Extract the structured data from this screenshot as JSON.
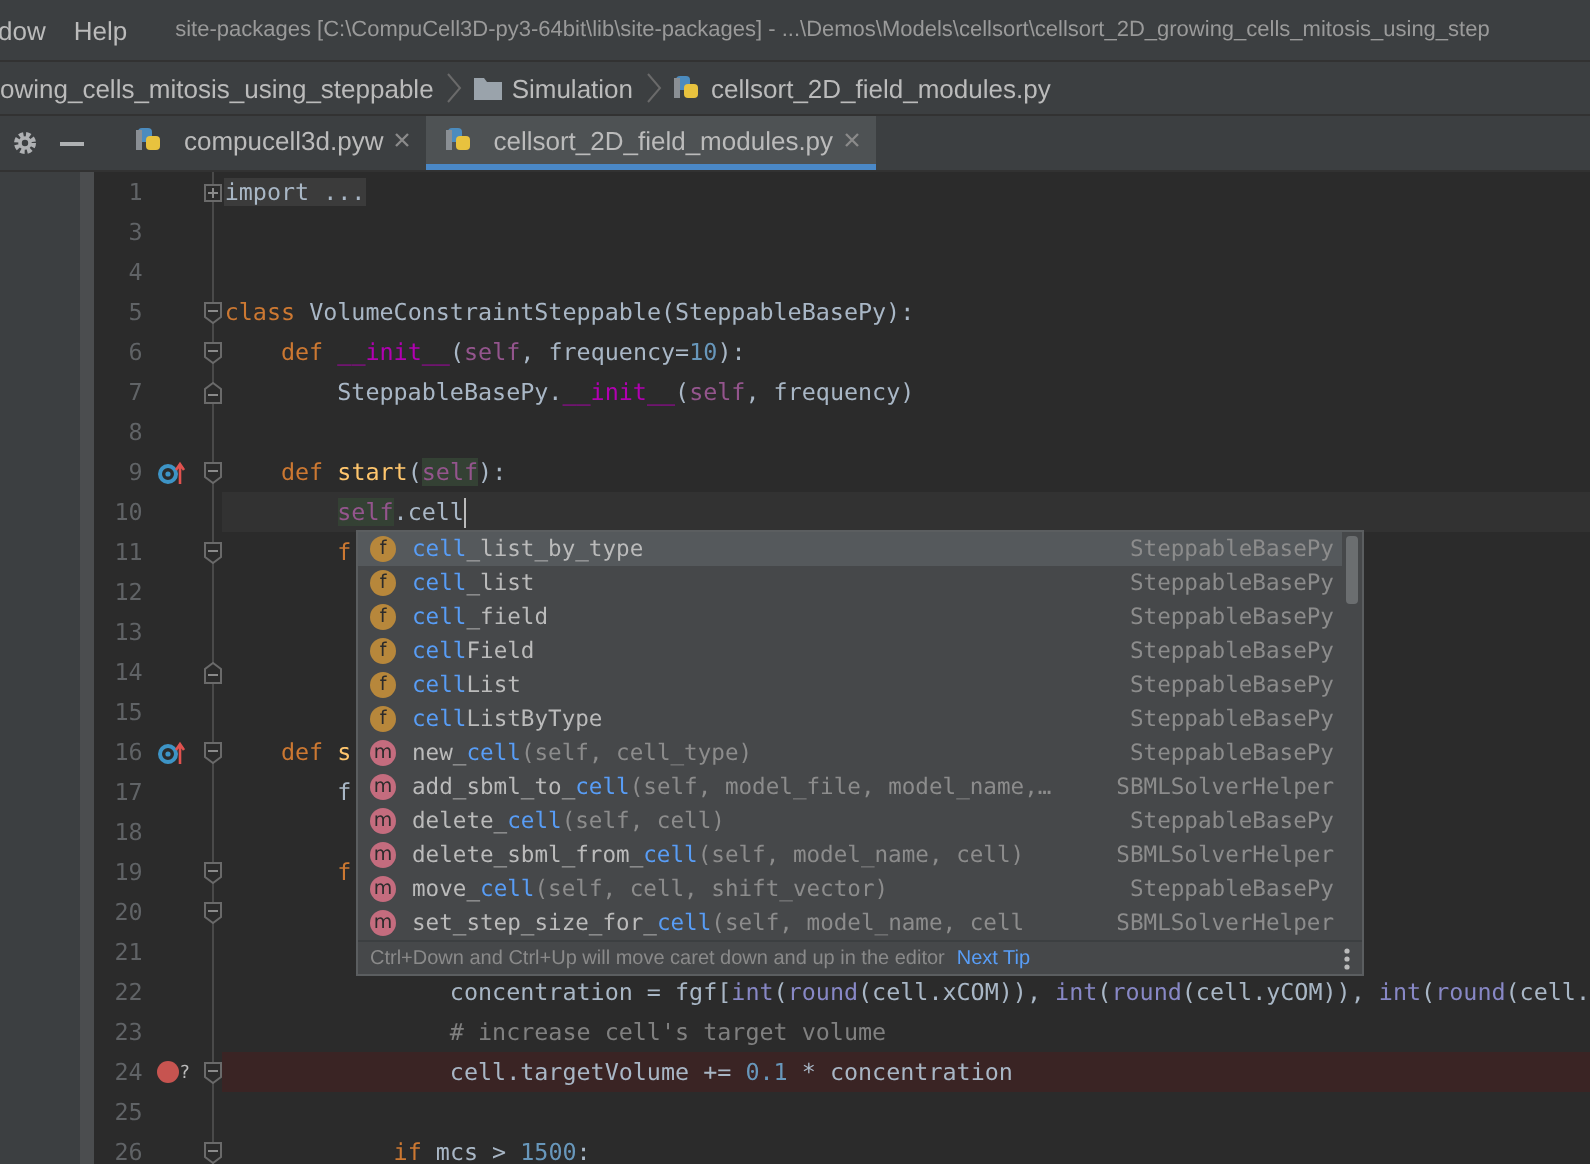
{
  "menu_bar": {
    "items": [
      {
        "label": "dow"
      },
      {
        "label": "Help"
      }
    ],
    "title": "site-packages [C:\\CompuCell3D-py3-64bit\\lib\\site-packages] - ...\\Demos\\Models\\cellsort\\cellsort_2D_growing_cells_mitosis_using_step"
  },
  "breadcrumbs": [
    {
      "label": "owing_cells_mitosis_using_steppable",
      "kind": "text"
    },
    {
      "label": "Simulation",
      "kind": "folder"
    },
    {
      "label": "cellsort_2D_field_modules.py",
      "kind": "python"
    }
  ],
  "tabs": [
    {
      "label": "compucell3d.pyw",
      "selected": false
    },
    {
      "label": "cellsort_2D_field_modules.py",
      "selected": true
    }
  ],
  "editor": {
    "lines": [
      {
        "number": "1",
        "fold": {
          "kind": "expand"
        },
        "current": false,
        "tokens": [
          {
            "text": "import ...",
            "kind": "folded"
          }
        ]
      },
      {
        "number": "3",
        "current": false
      },
      {
        "number": "4",
        "current": false
      },
      {
        "number": "5",
        "fold": {
          "kind": "collapse"
        },
        "current": false,
        "tokens": [
          {
            "text": "class",
            "kind": "keyword"
          },
          {
            "text": " VolumeConstraintSteppable(SteppableBasePy):",
            "kind": "plain"
          }
        ]
      },
      {
        "number": "6",
        "fold": {
          "kind": "collapse"
        },
        "current": false,
        "tokens": [
          {
            "text": "    def",
            "kind": "keyword"
          },
          {
            "text": " __init__",
            "kind": "magic"
          },
          {
            "text": "(",
            "kind": "plain"
          },
          {
            "text": "self",
            "kind": "self"
          },
          {
            "text": ", frequency=",
            "kind": "plain"
          },
          {
            "text": "10",
            "kind": "number"
          },
          {
            "text": "):",
            "kind": "plain"
          }
        ]
      },
      {
        "number": "7",
        "fold": {
          "kind": "end"
        },
        "current": false,
        "tokens": [
          {
            "text": "        SteppableBasePy.",
            "kind": "plain"
          },
          {
            "text": "__init__",
            "kind": "magic"
          },
          {
            "text": "(",
            "kind": "plain"
          },
          {
            "text": "self",
            "kind": "self"
          },
          {
            "text": ", frequency)",
            "kind": "plain"
          }
        ]
      },
      {
        "number": "8",
        "current": false
      },
      {
        "number": "9",
        "fold": {
          "kind": "collapse"
        },
        "marker": {
          "kind": "override"
        },
        "current": false,
        "tokens": [
          {
            "text": "    def",
            "kind": "keyword"
          },
          {
            "text": " start",
            "kind": "function"
          },
          {
            "text": "(",
            "kind": "plain"
          },
          {
            "text": "self",
            "kind": "self-usage"
          },
          {
            "text": "):",
            "kind": "plain"
          }
        ]
      },
      {
        "number": "10",
        "current": true,
        "tokens": [
          {
            "text": "        self",
            "kind": "self-usage"
          },
          {
            "text": ".cell",
            "kind": "plain"
          }
        ]
      },
      {
        "number": "11",
        "fold": {
          "kind": "collapse"
        },
        "current": false,
        "tokens": [
          {
            "text": "        f",
            "kind": "keyword"
          }
        ]
      },
      {
        "number": "12",
        "current": false
      },
      {
        "number": "13",
        "current": false
      },
      {
        "number": "14",
        "fold": {
          "kind": "end"
        },
        "current": false
      },
      {
        "number": "15",
        "current": false
      },
      {
        "number": "16",
        "fold": {
          "kind": "collapse"
        },
        "marker": {
          "kind": "override"
        },
        "current": false,
        "tokens": [
          {
            "text": "    def",
            "kind": "keyword"
          },
          {
            "text": " s",
            "kind": "function"
          }
        ]
      },
      {
        "number": "17",
        "current": false,
        "tokens": [
          {
            "text": "        f",
            "kind": "plain"
          }
        ]
      },
      {
        "number": "18",
        "current": false
      },
      {
        "number": "19",
        "fold": {
          "kind": "collapse"
        },
        "current": false,
        "tokens": [
          {
            "text": "        f",
            "kind": "keyword"
          }
        ]
      },
      {
        "number": "20",
        "fold": {
          "kind": "collapse"
        },
        "current": false
      },
      {
        "number": "21",
        "current": false
      },
      {
        "number": "22",
        "current": false,
        "tokens": [
          {
            "text": "                concentration = fgf[",
            "kind": "plain"
          },
          {
            "text": "int",
            "kind": "builtin"
          },
          {
            "text": "(",
            "kind": "plain"
          },
          {
            "text": "round",
            "kind": "builtin"
          },
          {
            "text": "(cell.xCOM)), ",
            "kind": "plain"
          },
          {
            "text": "int",
            "kind": "builtin"
          },
          {
            "text": "(",
            "kind": "plain"
          },
          {
            "text": "round",
            "kind": "builtin"
          },
          {
            "text": "(cell.yCOM)), ",
            "kind": "plain"
          },
          {
            "text": "int",
            "kind": "builtin"
          },
          {
            "text": "(",
            "kind": "plain"
          },
          {
            "text": "round",
            "kind": "builtin"
          },
          {
            "text": "(cell.",
            "kind": "plain"
          }
        ]
      },
      {
        "number": "23",
        "current": false,
        "tokens": [
          {
            "text": "                # increase cell's target volume",
            "kind": "comment"
          }
        ]
      },
      {
        "number": "24",
        "fold": {
          "kind": "collapse"
        },
        "marker": {
          "kind": "breakpoint",
          "label": "?"
        },
        "current": false,
        "tokens": [
          {
            "text": "                cell.targetVolume += ",
            "kind": "plain"
          },
          {
            "text": "0.1",
            "kind": "number"
          },
          {
            "text": " * concentration",
            "kind": "plain"
          }
        ]
      },
      {
        "number": "25",
        "current": false
      },
      {
        "number": "26",
        "fold": {
          "kind": "collapse"
        },
        "current": false,
        "tokens": [
          {
            "text": "            if",
            "kind": "keyword"
          },
          {
            "text": " mcs > ",
            "kind": "plain"
          },
          {
            "text": "1500",
            "kind": "number"
          },
          {
            "text": ":",
            "kind": "plain"
          }
        ]
      }
    ]
  },
  "completion": {
    "items": [
      {
        "kind": "field",
        "icon_letter": "f",
        "selected": true,
        "name_parts": [
          {
            "text": "cell",
            "matched": true
          },
          {
            "text": "_list_by_type",
            "matched": false
          }
        ],
        "source": "SteppableBasePy"
      },
      {
        "kind": "field",
        "icon_letter": "f",
        "selected": false,
        "name_parts": [
          {
            "text": "cell",
            "matched": true
          },
          {
            "text": "_list",
            "matched": false
          }
        ],
        "source": "SteppableBasePy"
      },
      {
        "kind": "field",
        "icon_letter": "f",
        "selected": false,
        "name_parts": [
          {
            "text": "cell",
            "matched": true
          },
          {
            "text": "_field",
            "matched": false
          }
        ],
        "source": "SteppableBasePy"
      },
      {
        "kind": "field",
        "icon_letter": "f",
        "selected": false,
        "name_parts": [
          {
            "text": "cell",
            "matched": true
          },
          {
            "text": "Field",
            "matched": false
          }
        ],
        "source": "SteppableBasePy"
      },
      {
        "kind": "field",
        "icon_letter": "f",
        "selected": false,
        "name_parts": [
          {
            "text": "cell",
            "matched": true
          },
          {
            "text": "List",
            "matched": false
          }
        ],
        "source": "SteppableBasePy"
      },
      {
        "kind": "field",
        "icon_letter": "f",
        "selected": false,
        "name_parts": [
          {
            "text": "cell",
            "matched": true
          },
          {
            "text": "ListByType",
            "matched": false
          }
        ],
        "source": "SteppableBasePy"
      },
      {
        "kind": "method",
        "icon_letter": "m",
        "selected": false,
        "name_parts": [
          {
            "text": "new_",
            "matched": false
          },
          {
            "text": "cell",
            "matched": true
          }
        ],
        "params": "(self, cell_type)",
        "source": "SteppableBasePy"
      },
      {
        "kind": "method",
        "icon_letter": "m",
        "selected": false,
        "name_parts": [
          {
            "text": "add_sbml_to_",
            "matched": false
          },
          {
            "text": "cell",
            "matched": true
          }
        ],
        "params": "(self, model_file, model_name,…",
        "source": "SBMLSolverHelper"
      },
      {
        "kind": "method",
        "icon_letter": "m",
        "selected": false,
        "name_parts": [
          {
            "text": "delete_",
            "matched": false
          },
          {
            "text": "cell",
            "matched": true
          }
        ],
        "params": "(self, cell)",
        "source": "SteppableBasePy"
      },
      {
        "kind": "method",
        "icon_letter": "m",
        "selected": false,
        "name_parts": [
          {
            "text": "delete_sbml_from_",
            "matched": false
          },
          {
            "text": "cell",
            "matched": true
          }
        ],
        "params": "(self, model_name, cell)",
        "source": "SBMLSolverHelper"
      },
      {
        "kind": "method",
        "icon_letter": "m",
        "selected": false,
        "name_parts": [
          {
            "text": "move_",
            "matched": false
          },
          {
            "text": "cell",
            "matched": true
          }
        ],
        "params": "(self, cell, shift_vector)",
        "source": "SteppableBasePy"
      },
      {
        "kind": "method",
        "icon_letter": "m",
        "selected": false,
        "name_parts": [
          {
            "text": "set_step_size_for_",
            "matched": false
          },
          {
            "text": "cell",
            "matched": true
          }
        ],
        "params": "(self, model_name, cell",
        "source": "SBMLSolverHelper"
      }
    ],
    "hint": "Ctrl+Down and Ctrl+Up will move caret down and up in the editor",
    "hint_link": "Next Tip"
  }
}
